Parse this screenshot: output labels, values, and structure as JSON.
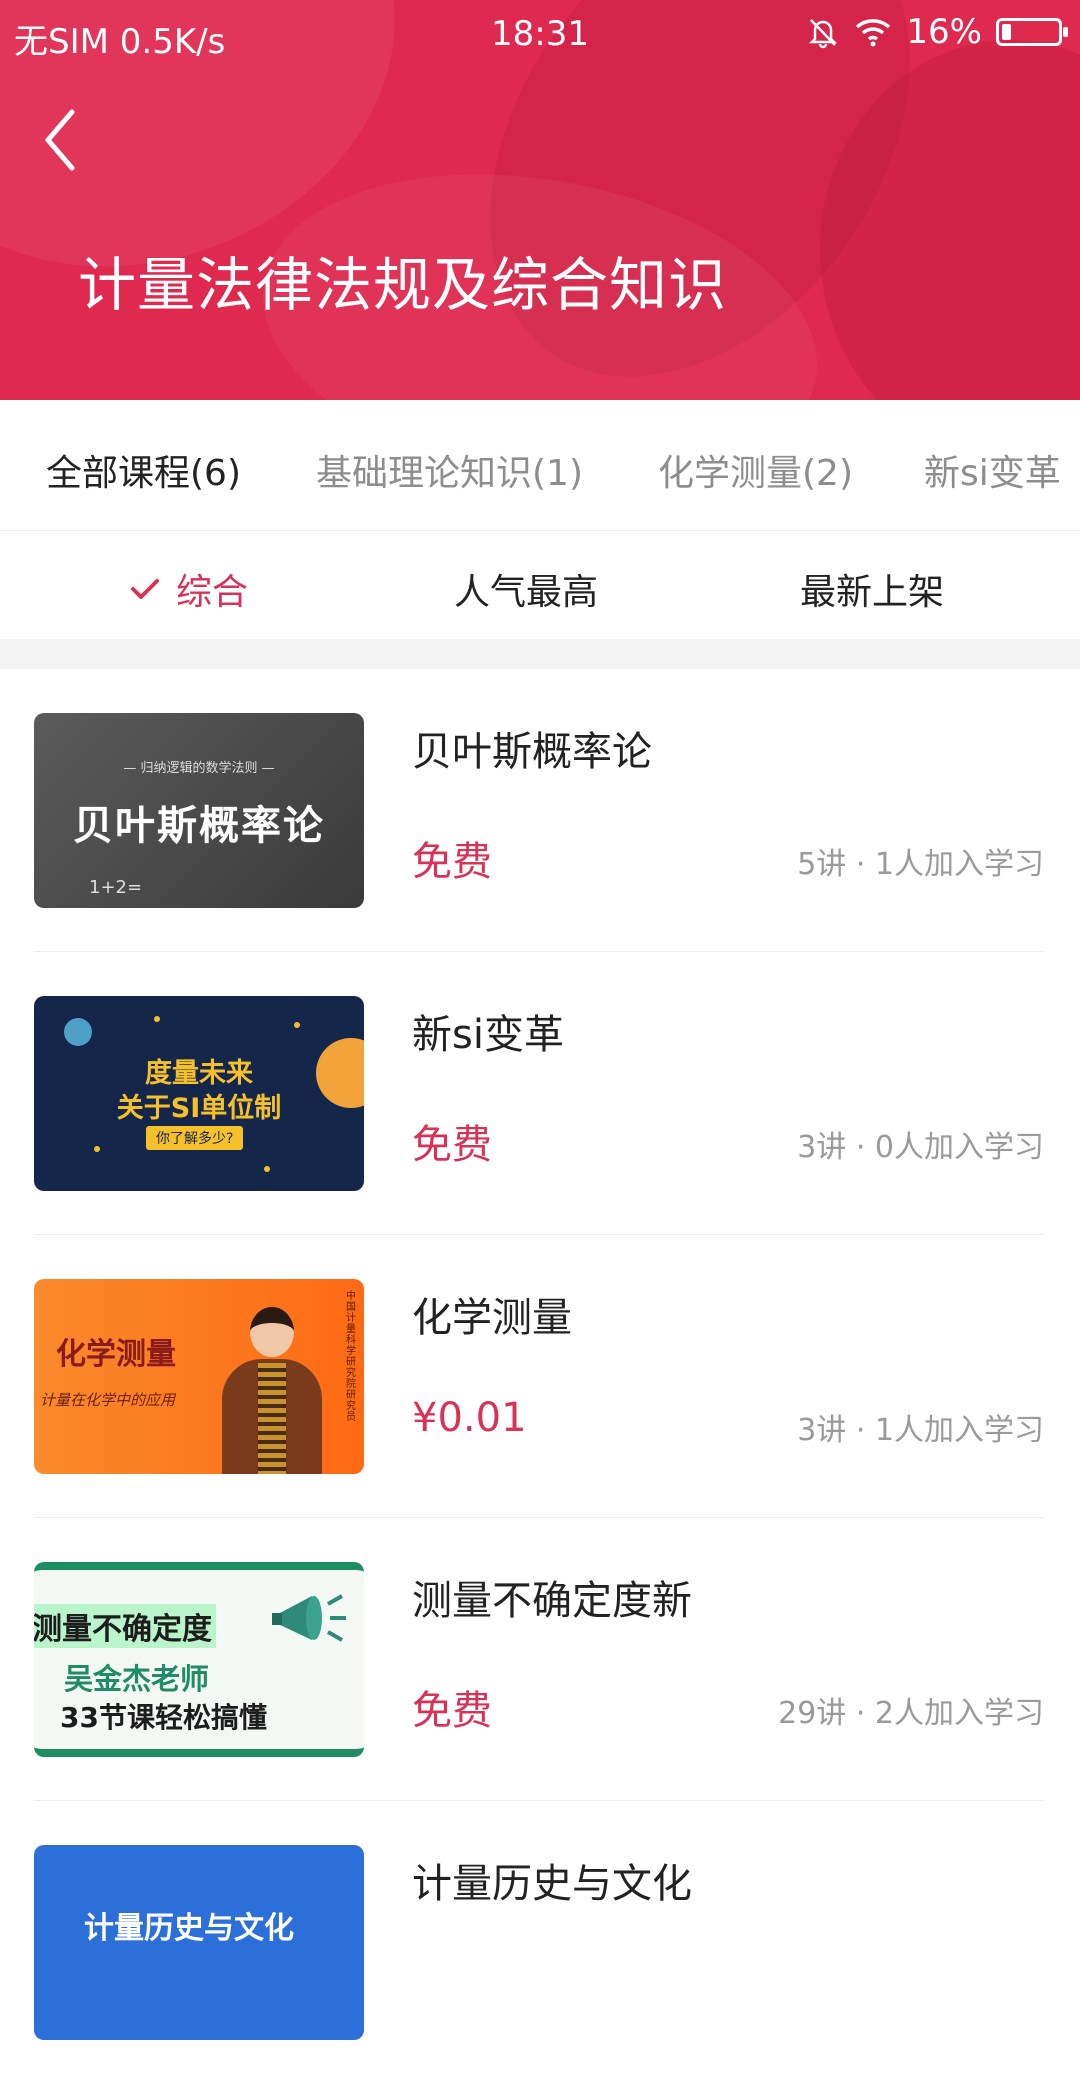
{
  "status_bar": {
    "carrier": "无SIM 0.5K/s",
    "time": "18:31",
    "battery": "16%",
    "battery_level": 0.16
  },
  "header": {
    "title": "计量法律法规及综合知识"
  },
  "tabs": [
    {
      "label": "全部课程(6)",
      "active": true
    },
    {
      "label": "基础理论知识(1)",
      "active": false
    },
    {
      "label": "化学测量(2)",
      "active": false
    },
    {
      "label": "新si变革",
      "active": false
    }
  ],
  "sort": [
    {
      "label": "综合",
      "active": true
    },
    {
      "label": "人气最高",
      "active": false
    },
    {
      "label": "最新上架",
      "active": false
    }
  ],
  "courses": [
    {
      "title": "贝叶斯概率论",
      "price": "免费",
      "meta": "5讲 · 1人加入学习",
      "thumb": {
        "small": "— 归纳逻辑的数学法则 —",
        "big": "贝叶斯概率论",
        "formula": "1+2="
      }
    },
    {
      "title": "新si变革",
      "price": "免费",
      "meta": "3讲 · 0人加入学习",
      "thumb": {
        "line1": "度量未来",
        "line2": "关于SI单位制",
        "tag": "你了解多少?"
      }
    },
    {
      "title": "化学测量",
      "price": "¥0.01",
      "meta": "3讲 · 1人加入学习",
      "thumb": {
        "main": "化学测量",
        "sub": "计量在化学中的应用",
        "vtext": "中国计量科学研究院 研究员"
      }
    },
    {
      "title": "测量不确定度新",
      "price": "免费",
      "meta": "29讲 · 2人加入学习",
      "thumb": {
        "l1": "测量不确定度",
        "l2": "吴金杰老师",
        "l3": "33节课轻松搞懂"
      }
    },
    {
      "title": "计量历史与文化",
      "price": "",
      "meta": "",
      "thumb": {
        "l1": "计量历史与文化"
      }
    }
  ],
  "colors": {
    "brand": "#e0294f",
    "accent": "#d93257"
  }
}
